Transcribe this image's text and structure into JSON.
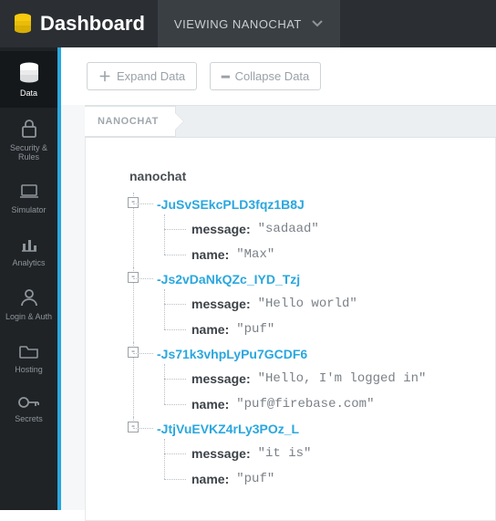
{
  "header": {
    "title": "Dashboard",
    "viewing_label": "VIEWING NANOCHAT"
  },
  "sidebar": {
    "items": [
      {
        "id": "data",
        "label": "Data",
        "active": true
      },
      {
        "id": "security",
        "label": "Security & Rules"
      },
      {
        "id": "simulator",
        "label": "Simulator"
      },
      {
        "id": "analytics",
        "label": "Analytics"
      },
      {
        "id": "login",
        "label": "Login & Auth"
      },
      {
        "id": "hosting",
        "label": "Hosting"
      },
      {
        "id": "secrets",
        "label": "Secrets"
      }
    ]
  },
  "toolbar": {
    "expand_label": "Expand Data",
    "collapse_label": "Collapse Data"
  },
  "breadcrumb": {
    "root": "NANOCHAT"
  },
  "tree": {
    "root_label": "nanochat",
    "nodes": [
      {
        "key": "-JuSvSEkcPLD3fqz1B8J",
        "fields": [
          {
            "name": "message",
            "value": "\"sadaad\""
          },
          {
            "name": "name",
            "value": "\"Max\""
          }
        ]
      },
      {
        "key": "-Js2vDaNkQZc_IYD_Tzj",
        "fields": [
          {
            "name": "message",
            "value": "\"Hello world\""
          },
          {
            "name": "name",
            "value": "\"puf\""
          }
        ]
      },
      {
        "key": "-Js71k3vhpLyPu7GCDF6",
        "fields": [
          {
            "name": "message",
            "value": "\"Hello, I'm logged in\""
          },
          {
            "name": "name",
            "value": "\"puf@firebase.com\""
          }
        ]
      },
      {
        "key": "-JtjVuEVKZ4rLy3POz_L",
        "fields": [
          {
            "name": "message",
            "value": "\"it is\""
          },
          {
            "name": "name",
            "value": "\"puf\""
          }
        ]
      }
    ]
  }
}
